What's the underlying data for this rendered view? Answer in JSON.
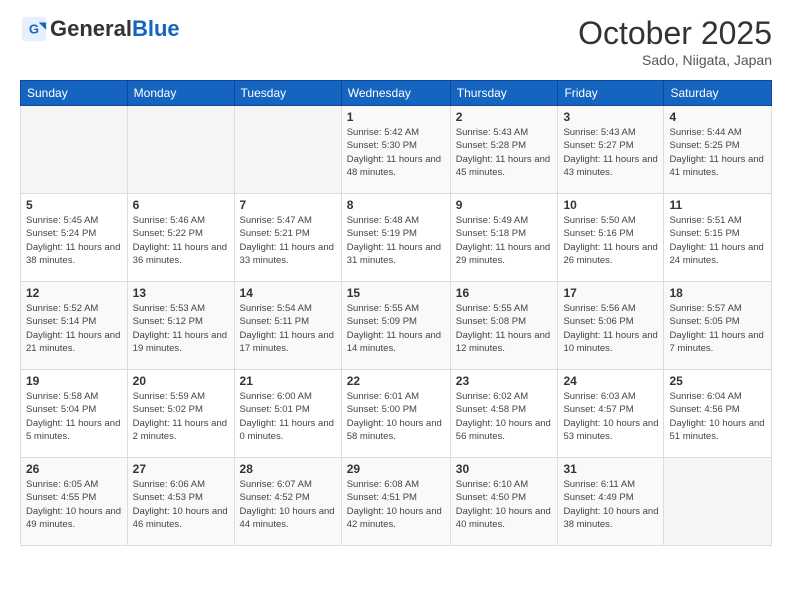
{
  "header": {
    "logo_line1": "General",
    "logo_line2": "Blue",
    "month": "October 2025",
    "location": "Sado, Niigata, Japan"
  },
  "days_of_week": [
    "Sunday",
    "Monday",
    "Tuesday",
    "Wednesday",
    "Thursday",
    "Friday",
    "Saturday"
  ],
  "weeks": [
    [
      {
        "day": "",
        "info": ""
      },
      {
        "day": "",
        "info": ""
      },
      {
        "day": "",
        "info": ""
      },
      {
        "day": "1",
        "info": "Sunrise: 5:42 AM\nSunset: 5:30 PM\nDaylight: 11 hours\nand 48 minutes."
      },
      {
        "day": "2",
        "info": "Sunrise: 5:43 AM\nSunset: 5:28 PM\nDaylight: 11 hours\nand 45 minutes."
      },
      {
        "day": "3",
        "info": "Sunrise: 5:43 AM\nSunset: 5:27 PM\nDaylight: 11 hours\nand 43 minutes."
      },
      {
        "day": "4",
        "info": "Sunrise: 5:44 AM\nSunset: 5:25 PM\nDaylight: 11 hours\nand 41 minutes."
      }
    ],
    [
      {
        "day": "5",
        "info": "Sunrise: 5:45 AM\nSunset: 5:24 PM\nDaylight: 11 hours\nand 38 minutes."
      },
      {
        "day": "6",
        "info": "Sunrise: 5:46 AM\nSunset: 5:22 PM\nDaylight: 11 hours\nand 36 minutes."
      },
      {
        "day": "7",
        "info": "Sunrise: 5:47 AM\nSunset: 5:21 PM\nDaylight: 11 hours\nand 33 minutes."
      },
      {
        "day": "8",
        "info": "Sunrise: 5:48 AM\nSunset: 5:19 PM\nDaylight: 11 hours\nand 31 minutes."
      },
      {
        "day": "9",
        "info": "Sunrise: 5:49 AM\nSunset: 5:18 PM\nDaylight: 11 hours\nand 29 minutes."
      },
      {
        "day": "10",
        "info": "Sunrise: 5:50 AM\nSunset: 5:16 PM\nDaylight: 11 hours\nand 26 minutes."
      },
      {
        "day": "11",
        "info": "Sunrise: 5:51 AM\nSunset: 5:15 PM\nDaylight: 11 hours\nand 24 minutes."
      }
    ],
    [
      {
        "day": "12",
        "info": "Sunrise: 5:52 AM\nSunset: 5:14 PM\nDaylight: 11 hours\nand 21 minutes."
      },
      {
        "day": "13",
        "info": "Sunrise: 5:53 AM\nSunset: 5:12 PM\nDaylight: 11 hours\nand 19 minutes."
      },
      {
        "day": "14",
        "info": "Sunrise: 5:54 AM\nSunset: 5:11 PM\nDaylight: 11 hours\nand 17 minutes."
      },
      {
        "day": "15",
        "info": "Sunrise: 5:55 AM\nSunset: 5:09 PM\nDaylight: 11 hours\nand 14 minutes."
      },
      {
        "day": "16",
        "info": "Sunrise: 5:55 AM\nSunset: 5:08 PM\nDaylight: 11 hours\nand 12 minutes."
      },
      {
        "day": "17",
        "info": "Sunrise: 5:56 AM\nSunset: 5:06 PM\nDaylight: 11 hours\nand 10 minutes."
      },
      {
        "day": "18",
        "info": "Sunrise: 5:57 AM\nSunset: 5:05 PM\nDaylight: 11 hours\nand 7 minutes."
      }
    ],
    [
      {
        "day": "19",
        "info": "Sunrise: 5:58 AM\nSunset: 5:04 PM\nDaylight: 11 hours\nand 5 minutes."
      },
      {
        "day": "20",
        "info": "Sunrise: 5:59 AM\nSunset: 5:02 PM\nDaylight: 11 hours\nand 2 minutes."
      },
      {
        "day": "21",
        "info": "Sunrise: 6:00 AM\nSunset: 5:01 PM\nDaylight: 11 hours\nand 0 minutes."
      },
      {
        "day": "22",
        "info": "Sunrise: 6:01 AM\nSunset: 5:00 PM\nDaylight: 10 hours\nand 58 minutes."
      },
      {
        "day": "23",
        "info": "Sunrise: 6:02 AM\nSunset: 4:58 PM\nDaylight: 10 hours\nand 56 minutes."
      },
      {
        "day": "24",
        "info": "Sunrise: 6:03 AM\nSunset: 4:57 PM\nDaylight: 10 hours\nand 53 minutes."
      },
      {
        "day": "25",
        "info": "Sunrise: 6:04 AM\nSunset: 4:56 PM\nDaylight: 10 hours\nand 51 minutes."
      }
    ],
    [
      {
        "day": "26",
        "info": "Sunrise: 6:05 AM\nSunset: 4:55 PM\nDaylight: 10 hours\nand 49 minutes."
      },
      {
        "day": "27",
        "info": "Sunrise: 6:06 AM\nSunset: 4:53 PM\nDaylight: 10 hours\nand 46 minutes."
      },
      {
        "day": "28",
        "info": "Sunrise: 6:07 AM\nSunset: 4:52 PM\nDaylight: 10 hours\nand 44 minutes."
      },
      {
        "day": "29",
        "info": "Sunrise: 6:08 AM\nSunset: 4:51 PM\nDaylight: 10 hours\nand 42 minutes."
      },
      {
        "day": "30",
        "info": "Sunrise: 6:10 AM\nSunset: 4:50 PM\nDaylight: 10 hours\nand 40 minutes."
      },
      {
        "day": "31",
        "info": "Sunrise: 6:11 AM\nSunset: 4:49 PM\nDaylight: 10 hours\nand 38 minutes."
      },
      {
        "day": "",
        "info": ""
      }
    ]
  ]
}
